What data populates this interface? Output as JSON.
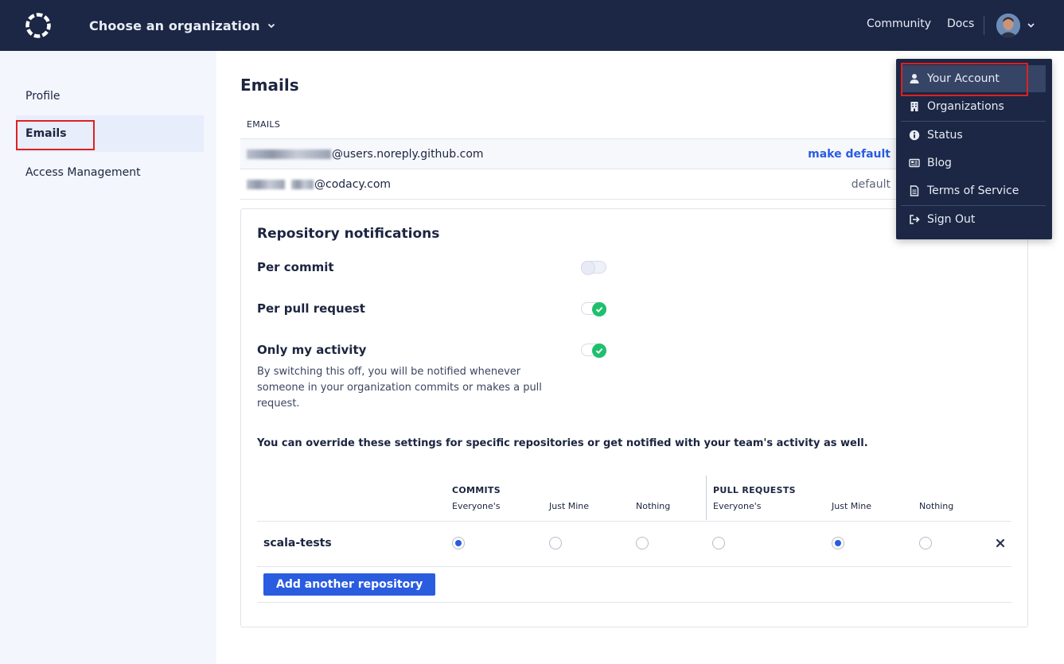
{
  "topbar": {
    "org_select_label": "Choose an organization",
    "community_link": "Community",
    "docs_link": "Docs"
  },
  "sidebar": {
    "items": [
      {
        "label": "Profile"
      },
      {
        "label": "Emails",
        "active": true
      },
      {
        "label": "Access Management"
      }
    ]
  },
  "main": {
    "title": "Emails",
    "emails_header": "EMAILS",
    "emails": [
      {
        "domain_part": "@users.noreply.github.com",
        "action": "make default"
      },
      {
        "domain_part": "@codacy.com",
        "status": "default"
      }
    ]
  },
  "notifications": {
    "title": "Repository notifications",
    "options": [
      {
        "label": "Per commit",
        "enabled": false
      },
      {
        "label": "Per pull request",
        "enabled": true
      },
      {
        "label": "Only my activity",
        "enabled": true,
        "description": "By switching this off, you will be notified whenever someone in your organization commits or makes a pull request."
      }
    ],
    "override_text": "You can override these settings for specific repositories or get notified with your team's activity as well.",
    "table": {
      "groups": [
        "COMMITS",
        "PULL REQUESTS"
      ],
      "columns": [
        "Everyone's",
        "Just Mine",
        "Nothing",
        "Everyone's",
        "Just Mine",
        "Nothing"
      ],
      "rows": [
        {
          "repo": "scala-tests",
          "commits_choice": "Everyone's",
          "pull_requests_choice": "Just Mine"
        }
      ]
    },
    "add_button": "Add another repository"
  },
  "dropdown": {
    "items": [
      {
        "label": "Your Account",
        "icon": "user-icon",
        "active": true
      },
      {
        "label": "Organizations",
        "icon": "building-icon"
      },
      {
        "label": "Status",
        "icon": "info-icon"
      },
      {
        "label": "Blog",
        "icon": "newspaper-icon"
      },
      {
        "label": "Terms of Service",
        "icon": "document-icon"
      },
      {
        "label": "Sign Out",
        "icon": "sign-out-icon"
      }
    ]
  },
  "colors": {
    "topbar_bg": "#1b2744",
    "accent_blue": "#2a5ce0",
    "toggle_on": "#1fbf6e",
    "highlight_red": "#e02020",
    "sidebar_bg": "#f3f6fd"
  }
}
